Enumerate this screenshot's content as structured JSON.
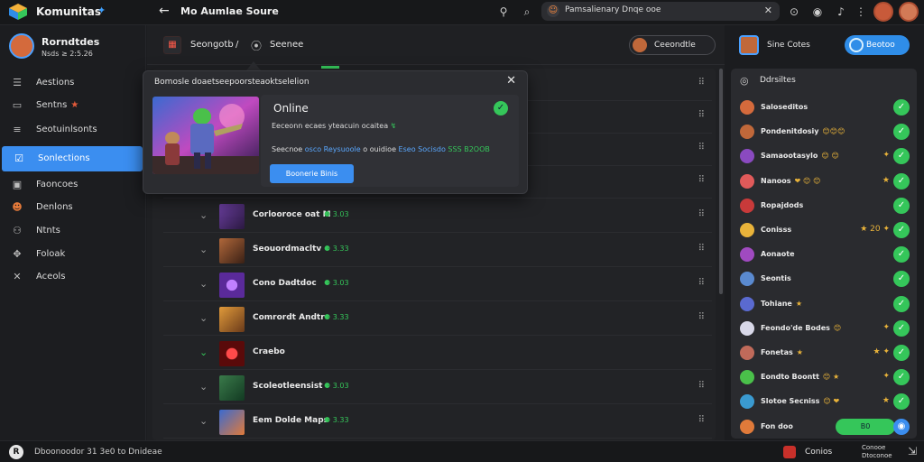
{
  "app": {
    "name": "Komunitas",
    "page_title": "Mo Aumlae Soure"
  },
  "search": {
    "text": "Pamsalienary Dnqe ooe"
  },
  "profile": {
    "name": "Rorndtdes",
    "sub": "Nsds ≥ 2:5.26"
  },
  "nav": [
    {
      "label": "Aestions",
      "icon": "menu-icon"
    },
    {
      "label": "Sentns",
      "icon": "monitor-icon",
      "star": "★"
    },
    {
      "label": "Seotuinlsonts",
      "icon": "list-icon"
    },
    {
      "label": "Sonlections",
      "icon": "check-square-icon"
    },
    {
      "label": "Faoncoes",
      "icon": "image-icon"
    },
    {
      "label": "Denlons",
      "icon": "avatar-icon"
    },
    {
      "label": "Ntnts",
      "icon": "link-icon"
    },
    {
      "label": "Foloak",
      "icon": "controller-icon"
    },
    {
      "label": "Aceols",
      "icon": "tools-icon"
    }
  ],
  "main": {
    "header_title": "Seongotb",
    "header_sep": "/",
    "header_sub": "Seenee",
    "header_button": "Ceeondtle"
  },
  "popover": {
    "header": "Bomosle doaetseepoorsteaoktselelion",
    "title": "Online",
    "line1": "Eeceonn ecaes yteacuin ocaitea",
    "line1_mark": "↯",
    "line2_a": "Seecnoe",
    "line2_link1": "osco Reysuoole",
    "line2_b": "o ouidioe",
    "line2_link2": "Eseo Socisdo",
    "line2_c": "SSS B2OOB",
    "button": "Boonerie Binis"
  },
  "rows": [
    {
      "name": "Corlooroce oat M",
      "stat": "⚈ 3.03",
      "chev": "⌄"
    },
    {
      "name": "Seouordmacltv",
      "stat": "⚈ 3.33",
      "chev": "⌄"
    },
    {
      "name": "Cono Dadtdoc",
      "stat": "⚈ 3.03",
      "chev": "⌄"
    },
    {
      "name": "Comrordt Andtr",
      "stat": "⚈ 3.33",
      "chev": "⌄"
    },
    {
      "name": "Craebo",
      "stat": "",
      "chev": "⌄"
    },
    {
      "name": "Scoleotleensist",
      "stat": "⚈ 3.03",
      "chev": "⌄"
    },
    {
      "name": "Eem Dolde Maps",
      "stat": "⚈ 3.33",
      "chev": "⌄"
    }
  ],
  "right_top": {
    "title": "Sine Cotes",
    "button": "Beotoo"
  },
  "right_panel": {
    "header": "Ddrsiltes",
    "friends": [
      {
        "name": "Saloseditos",
        "extra": ""
      },
      {
        "name": "Pondenitdosiy",
        "emoji": "😊😊😊",
        "extra": ""
      },
      {
        "name": "Samaootasylo",
        "emoji": "😊 😊",
        "extra": "✦"
      },
      {
        "name": "Nanoos",
        "emoji": "❤ 😊 😊",
        "extra": "★"
      },
      {
        "name": "Ropajdods",
        "extra": ""
      },
      {
        "name": "Conisss",
        "extra": "★ 20 ✦"
      },
      {
        "name": "Aonaote",
        "extra": ""
      },
      {
        "name": "Seontis",
        "extra": ""
      },
      {
        "name": "Tohiane",
        "emoji": "★",
        "extra": ""
      },
      {
        "name": "Feondo'de Bodes",
        "emoji": "😊",
        "extra": "✦"
      },
      {
        "name": "Fonetas",
        "emoji": "★",
        "extra": "★ ✦"
      },
      {
        "name": "Eondto Boontt",
        "emoji": "😊 ★",
        "extra": "✦"
      },
      {
        "name": "Slotoe Secniss",
        "emoji": "😊 ❤",
        "extra": "★"
      },
      {
        "name": "Fon doo",
        "pill": "B0",
        "extra": ""
      }
    ]
  },
  "bottom": {
    "left": "Dboonoodor 31 3e0 to Dnideae",
    "right": "Conios",
    "right_sub1": "Conooe",
    "right_sub2": "Dtoconoe"
  },
  "colors": {
    "accent": "#3b8ef0",
    "success": "#35c65a",
    "background": "#1b1c1f"
  }
}
